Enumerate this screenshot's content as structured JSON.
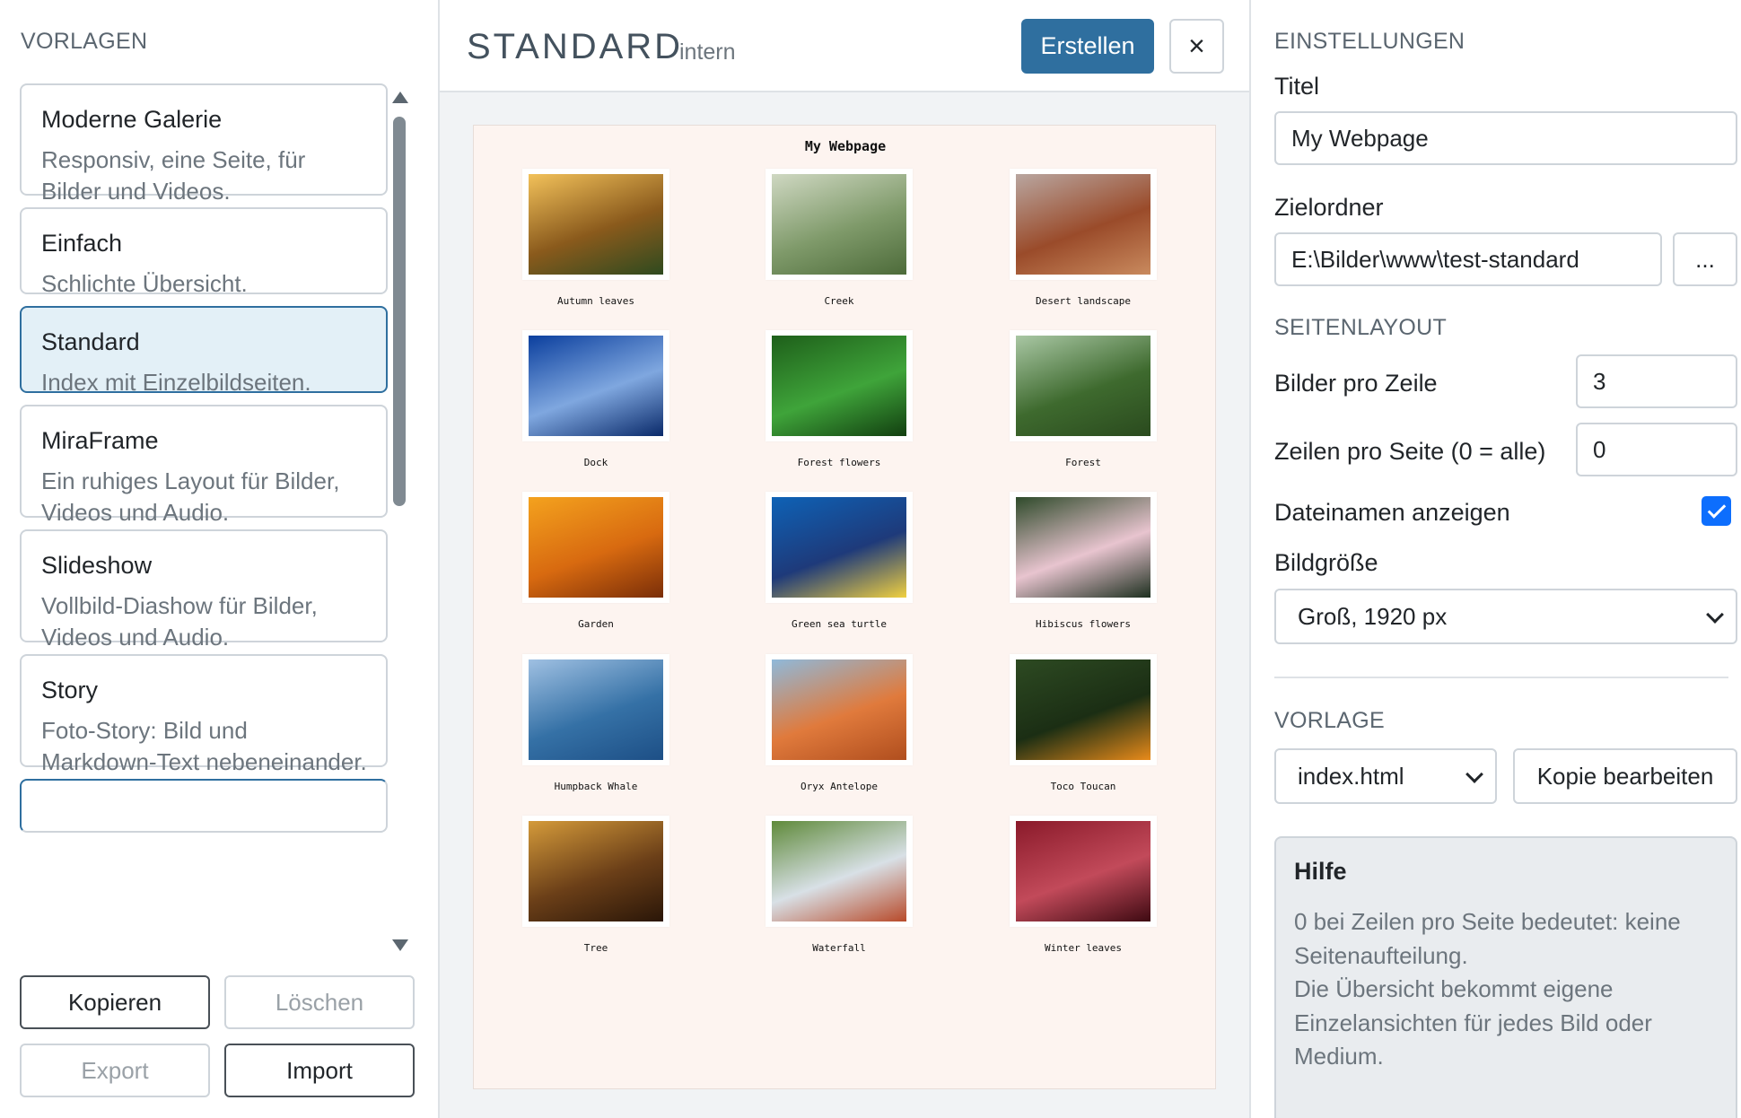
{
  "left": {
    "title": "VORLAGEN",
    "templates": [
      {
        "name": "Moderne Galerie",
        "desc": "Responsiv, eine Seite, für Bilder und Videos."
      },
      {
        "name": "Einfach",
        "desc": "Schlichte Übersicht."
      },
      {
        "name": "Standard",
        "desc": "Index mit Einzelbildseiten."
      },
      {
        "name": "MiraFrame",
        "desc": "Ein ruhiges Layout für Bilder, Videos und Audio."
      },
      {
        "name": "Slideshow",
        "desc": "Vollbild-Diashow für Bilder, Videos und Audio."
      },
      {
        "name": "Story",
        "desc": "Foto-Story: Bild und Markdown-Text nebeneinander."
      }
    ],
    "buttons": {
      "copy": "Kopieren",
      "delete": "Löschen",
      "export": "Export",
      "import": "Import"
    }
  },
  "center": {
    "title": "STANDARD",
    "tag": "intern",
    "create": "Erstellen",
    "close": "×",
    "preview": {
      "title": "My Webpage",
      "items": [
        {
          "caption": "Autumn leaves",
          "colors": [
            "#f2c15a",
            "#8a5a1c",
            "#2e4a1f"
          ]
        },
        {
          "caption": "Creek",
          "colors": [
            "#cfd8c2",
            "#7f9a6a",
            "#4d6b3a"
          ]
        },
        {
          "caption": "Desert landscape",
          "colors": [
            "#b9a6a0",
            "#9a4b2a",
            "#c98a5e"
          ]
        },
        {
          "caption": "Dock",
          "colors": [
            "#0b3f9e",
            "#7fa7df",
            "#0a2a6a"
          ]
        },
        {
          "caption": "Forest flowers",
          "colors": [
            "#1e5f1a",
            "#3fa43a",
            "#123f10"
          ]
        },
        {
          "caption": "Forest",
          "colors": [
            "#a9c7a4",
            "#3e6a2e",
            "#2a4a1e"
          ]
        },
        {
          "caption": "Garden",
          "colors": [
            "#f4a21e",
            "#d86a10",
            "#7a2e08"
          ]
        },
        {
          "caption": "Green sea turtle",
          "colors": [
            "#0e62b6",
            "#1e3a7a",
            "#f0d040"
          ]
        },
        {
          "caption": "Hibiscus flowers",
          "colors": [
            "#2e4a2a",
            "#e8c4cf",
            "#1e3020"
          ]
        },
        {
          "caption": "Humpback Whale",
          "colors": [
            "#9fc0e2",
            "#3571a6",
            "#1d4f86"
          ]
        },
        {
          "caption": "Oryx Antelope",
          "colors": [
            "#8fb9da",
            "#e07a3c",
            "#b04e1e"
          ]
        },
        {
          "caption": "Toco Toucan",
          "colors": [
            "#2d4a22",
            "#1b2e14",
            "#e88a1a"
          ]
        },
        {
          "caption": "Tree",
          "colors": [
            "#d49a3a",
            "#6b3f18",
            "#2a1608"
          ]
        },
        {
          "caption": "Waterfall",
          "colors": [
            "#5f8a3a",
            "#d8e0e6",
            "#b84a2a"
          ]
        },
        {
          "caption": "Winter leaves",
          "colors": [
            "#8a1a2a",
            "#c24a5a",
            "#3e0a12"
          ]
        }
      ]
    }
  },
  "right": {
    "settings_title": "EINSTELLUNGEN",
    "title_label": "Titel",
    "title_value": "My Webpage",
    "folder_label": "Zielordner",
    "folder_value": "E:\\Bilder\\www\\test-standard",
    "browse": "...",
    "layout_title": "SEITENLAYOUT",
    "per_row_label": "Bilder pro Zeile",
    "per_row_value": "3",
    "rows_label": "Zeilen pro Seite (0 = alle)",
    "rows_value": "0",
    "show_names_label": "Dateinamen anzeigen",
    "show_names_checked": true,
    "size_label": "Bildgröße",
    "size_value": "Groß, 1920 px",
    "template_title": "VORLAGE",
    "template_file": "index.html",
    "edit_copy": "Kopie bearbeiten",
    "help_title": "Hilfe",
    "help_text": "0 bei Zeilen pro Seite bedeutet: keine Seitenaufteilung.\nDie Übersicht bekommt eigene Einzelansichten für jedes Bild oder Medium."
  },
  "accent": "#2f6f9f"
}
